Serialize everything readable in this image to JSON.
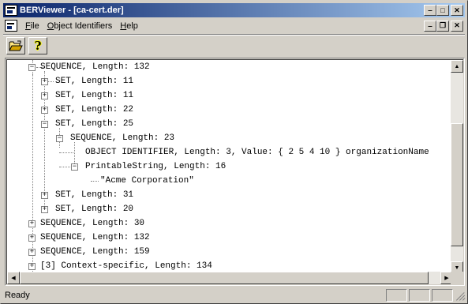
{
  "window": {
    "title": "BERViewer - [ca-cert.der]",
    "minimize_glyph": "‒",
    "maximize_glyph": "□",
    "close_glyph": "✕"
  },
  "menu": {
    "file": {
      "key": "F",
      "rest": "ile"
    },
    "oid": {
      "key": "O",
      "rest": "bject Identifiers"
    },
    "help": {
      "key": "H",
      "rest": "elp"
    },
    "mdi_minimize_glyph": "‒",
    "mdi_restore_glyph": "❐",
    "mdi_close_glyph": "✕"
  },
  "toolbar": {
    "open_icon": "open-folder-icon",
    "help_glyph": "?"
  },
  "tree": {
    "rows": [
      {
        "label": "SEQUENCE, Length: 132",
        "expander": "−"
      },
      {
        "label": "SET, Length: 11",
        "expander": "+"
      },
      {
        "label": "SET, Length: 11",
        "expander": "+"
      },
      {
        "label": "SET, Length: 22",
        "expander": "+"
      },
      {
        "label": "SET, Length: 25",
        "expander": "−"
      },
      {
        "label": "SEQUENCE, Length: 23",
        "expander": "−"
      },
      {
        "label": "OBJECT IDENTIFIER, Length: 3, Value: { 2 5 4 10 } organizationName",
        "expander": ""
      },
      {
        "label": "PrintableString, Length: 16",
        "expander": "−"
      },
      {
        "label": "\"Acme Corporation\"",
        "expander": ""
      },
      {
        "label": "SET, Length: 31",
        "expander": "+"
      },
      {
        "label": "SET, Length: 20",
        "expander": "+"
      },
      {
        "label": "SEQUENCE, Length: 30",
        "expander": "+"
      },
      {
        "label": "SEQUENCE, Length: 132",
        "expander": "+"
      },
      {
        "label": "SEQUENCE, Length: 159",
        "expander": "+"
      },
      {
        "label": "[3] Context-specific, Length: 134",
        "expander": "+"
      }
    ]
  },
  "scrollbar": {
    "up_glyph": "▲",
    "down_glyph": "▼",
    "left_glyph": "◀",
    "right_glyph": "▶"
  },
  "status": {
    "text": "Ready"
  },
  "colors": {
    "title_start": "#0a246a",
    "title_end": "#a6caf0",
    "face": "#d4d0c8",
    "tree_bg": "#ffffff"
  }
}
